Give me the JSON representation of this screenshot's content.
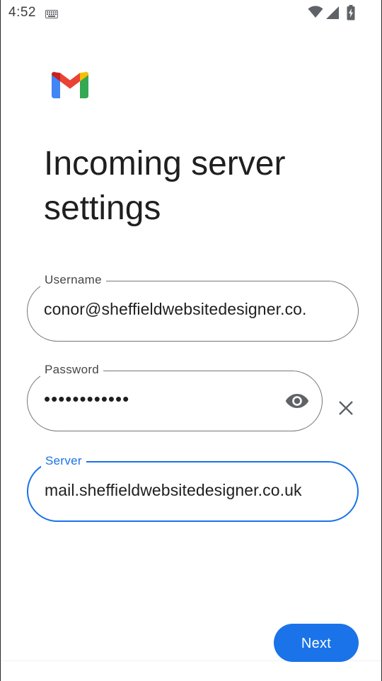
{
  "status_bar": {
    "time": "4:52",
    "icons": [
      "keyboard-icon",
      "wifi-icon",
      "signal-icon",
      "battery-charging-icon"
    ]
  },
  "app": {
    "logo": "gmail-logo",
    "colors": {
      "accent": "#1a73e8",
      "gmail_red": "#ea4335",
      "gmail_blue": "#4285f4",
      "gmail_green": "#34a853",
      "gmail_yellow": "#fbbc04"
    }
  },
  "page": {
    "title": "Incoming server settings"
  },
  "fields": {
    "username": {
      "label": "Username",
      "value": "conor@sheffieldwebsitedesigner.co."
    },
    "password": {
      "label": "Password",
      "value": "••••••••••••",
      "icon": "eye-icon",
      "clear_icon": "close-icon"
    },
    "server": {
      "label": "Server",
      "value": "mail.sheffieldwebsitedesigner.co.uk",
      "focused": true
    }
  },
  "actions": {
    "next_label": "Next"
  }
}
